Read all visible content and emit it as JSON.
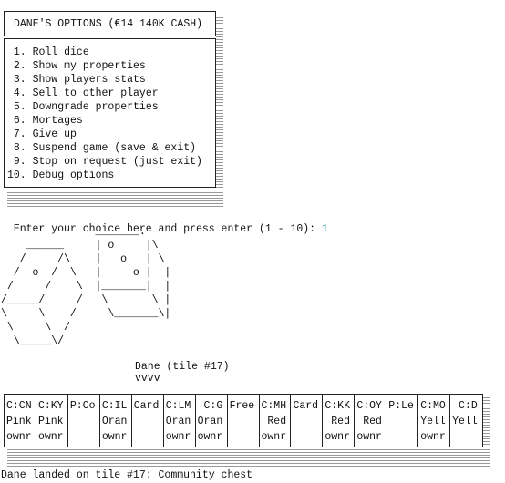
{
  "menu": {
    "title": "DANE'S OPTIONS (€14 140K CASH)",
    "items": [
      " 1. Roll dice",
      " 2. Show my properties",
      " 3. Show players stats",
      " 4. Sell to other player",
      " 5. Downgrade properties",
      " 6. Mortages",
      " 7. Give up",
      " 8. Suspend game (save & exit)",
      " 9. Stop on request (just exit)",
      "10. Debug options"
    ]
  },
  "prompt": {
    "text": "Enter your choice here and press enter (1 - 10): ",
    "input": "1",
    "input_color": "#2a9d9d"
  },
  "dice_art": "               _______.\n    ______     | o     |\\\n   /     /\\    |   o   | \\\n  /  o  /  \\   |     o |  |\n /     /    \\  |_______|  |\n/_____/     /   \\       \\ |\n\\     \\    /     \\_______\\|\n \\     \\  /\n  \\_____\\/",
  "player_marker": {
    "label": "Dane (tile #17)",
    "arrow": "vvvv"
  },
  "board": [
    [
      "C:CN",
      "Pink",
      "ownr"
    ],
    [
      "C:KY",
      "Pink",
      "ownr"
    ],
    [
      "P:Co",
      "",
      ""
    ],
    [
      "C:IL",
      "Oran",
      "ownr"
    ],
    [
      "Card",
      "",
      ""
    ],
    [
      "C:LM",
      "Oran",
      "ownr"
    ],
    [
      " C:G",
      "Oran",
      "ownr"
    ],
    [
      "Free",
      "",
      ""
    ],
    [
      "C:MH",
      " Red",
      "ownr"
    ],
    [
      "Card",
      "",
      ""
    ],
    [
      "C:KK",
      " Red",
      "ownr"
    ],
    [
      "C:OY",
      " Red",
      "ownr"
    ],
    [
      "P:Le",
      "",
      ""
    ],
    [
      "C:MO",
      "Yell",
      "ownr"
    ],
    [
      " C:D",
      "Yell",
      ""
    ]
  ],
  "status": "Dane landed on tile #17: Community chest"
}
